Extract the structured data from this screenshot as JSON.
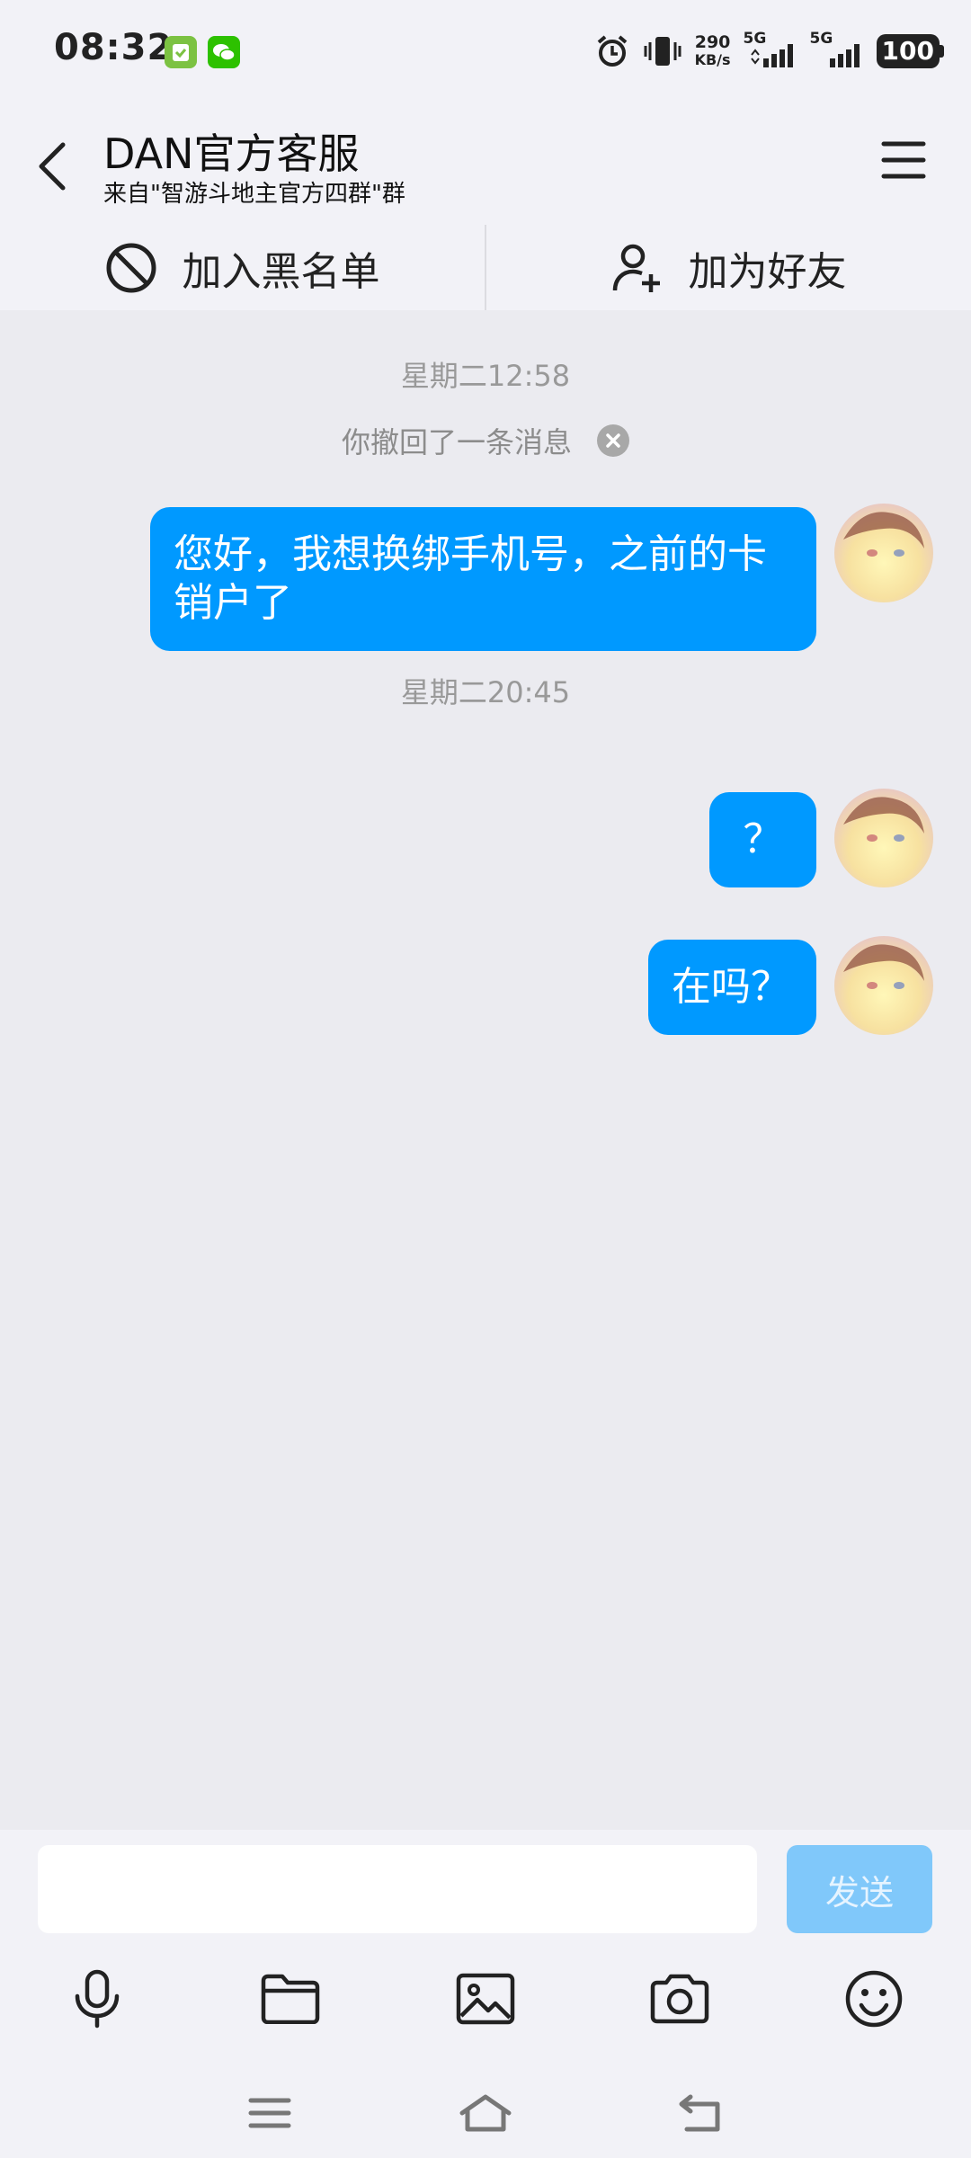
{
  "status_bar": {
    "time": "08:32",
    "net_speed_value": "290",
    "net_speed_unit": "KB/s",
    "signal1_label": "5G",
    "signal2_label": "5G",
    "battery": "100",
    "icons": [
      "wallet-app-icon",
      "wechat-icon",
      "alarm-icon",
      "vibrate-icon"
    ]
  },
  "header": {
    "title": "DAN官方客服",
    "subtitle": "来自\"智游斗地主官方四群\"群"
  },
  "actions": {
    "blacklist_label": "加入黑名单",
    "add_friend_label": "加为好友"
  },
  "chat": {
    "time1": "星期二12:58",
    "recall_notice": "你撤回了一条消息",
    "msg1": "您好，我想换绑手机号，之前的卡销户了",
    "time2": "星期二20:45",
    "msg2": "？",
    "msg3": "在吗？"
  },
  "input": {
    "value": "",
    "send_label": "发送"
  },
  "colors": {
    "accent": "#0099ff",
    "send_disabled": "#80c8fa",
    "chat_bg": "#ebebf0",
    "bar_bg": "#f2f2f7"
  }
}
